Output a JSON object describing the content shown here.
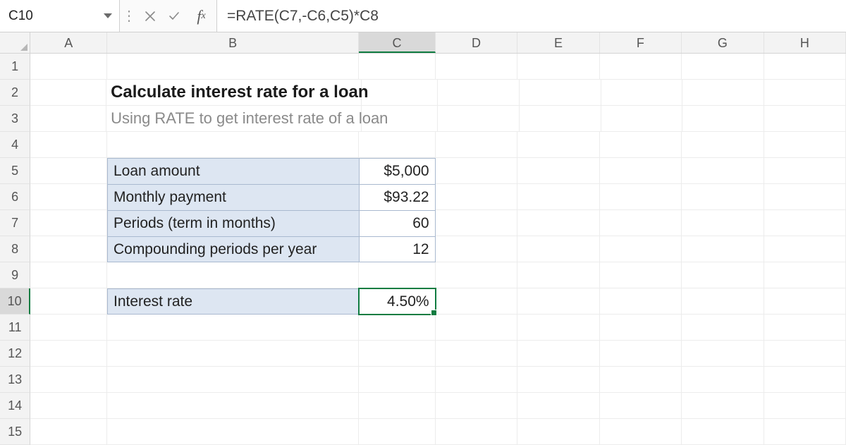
{
  "namebox": "C10",
  "formula": "=RATE(C7,-C6,C5)*C8",
  "columns": [
    "A",
    "B",
    "C",
    "D",
    "E",
    "F",
    "G",
    "H"
  ],
  "active_column": "C",
  "row_count": 15,
  "active_row": 10,
  "title": "Calculate interest rate for a loan",
  "subtitle": "Using RATE to get interest rate of a loan",
  "table": {
    "rows": [
      {
        "label": "Loan amount",
        "value": "$5,000"
      },
      {
        "label": "Monthly payment",
        "value": "$93.22"
      },
      {
        "label": "Periods (term in months)",
        "value": "60"
      },
      {
        "label": "Compounding periods per year",
        "value": "12"
      }
    ]
  },
  "result": {
    "label": "Interest rate",
    "value": "4.50%"
  }
}
